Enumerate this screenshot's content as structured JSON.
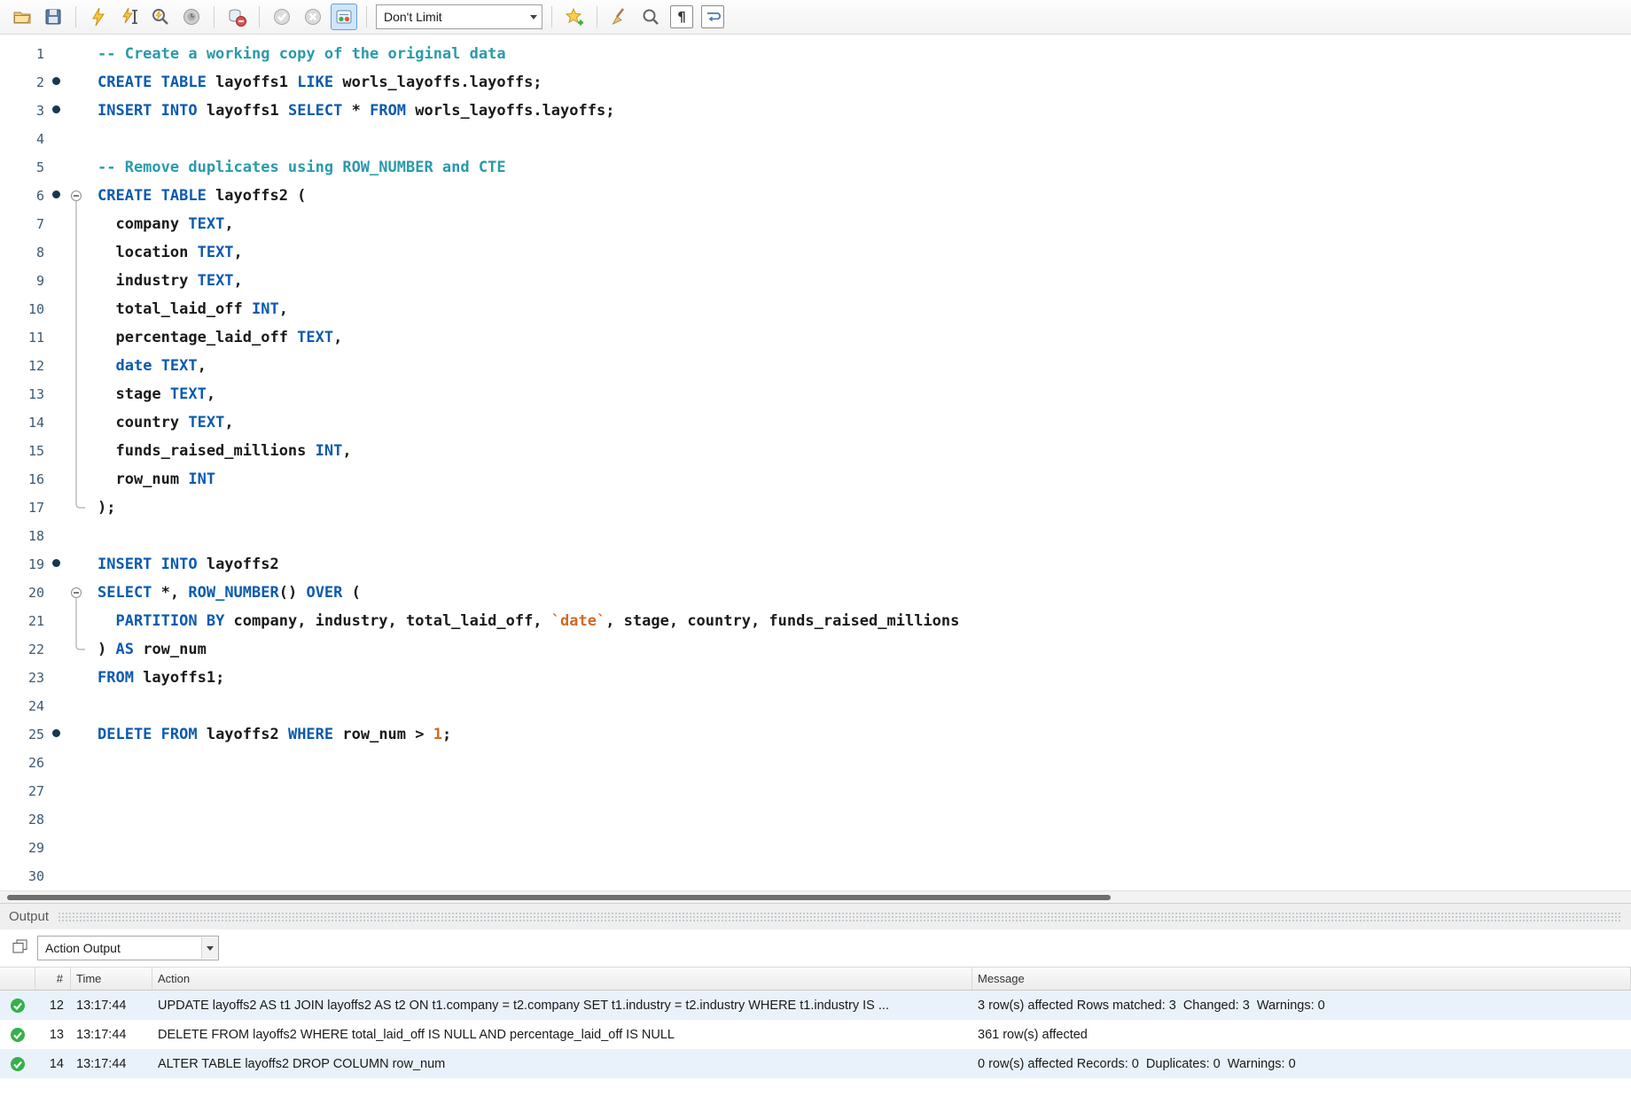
{
  "colors": {
    "keyword": "#0b5ab0",
    "comment": "#2a9aaa",
    "quoted": "#cf6a28",
    "number": "#d2691e",
    "success": "#35b04a"
  },
  "toolbar": {
    "limit_value": "Don't Limit",
    "invisibles_glyph": "¶",
    "icon_names": [
      "open-script-icon",
      "save-script-icon",
      "execute-icon",
      "execute-current-statement-icon",
      "explain-plan-icon",
      "stop-execution-icon",
      "stop-on-error-icon",
      "commit-icon",
      "rollback-icon",
      "autocommit-icon",
      "limit-rows-dropdown",
      "save-snippet-icon",
      "beautify-icon",
      "find-icon",
      "invisibles-icon",
      "wrap-text-icon"
    ]
  },
  "editor": {
    "lines": [
      {
        "n": 1,
        "seg": [
          [
            "cm",
            "-- Create a working copy of the original data"
          ]
        ]
      },
      {
        "n": 2,
        "dot": true,
        "seg": [
          [
            "kw",
            "CREATE TABLE"
          ],
          [
            "pl",
            " layoffs1 "
          ],
          [
            "kw",
            "LIKE"
          ],
          [
            "pl",
            " worls_layoffs.layoffs;"
          ]
        ]
      },
      {
        "n": 3,
        "dot": true,
        "seg": [
          [
            "kw",
            "INSERT INTO"
          ],
          [
            "pl",
            " layoffs1 "
          ],
          [
            "kw",
            "SELECT"
          ],
          [
            "pl",
            " * "
          ],
          [
            "kw",
            "FROM"
          ],
          [
            "pl",
            " worls_layoffs.layoffs;"
          ]
        ]
      },
      {
        "n": 4,
        "seg": []
      },
      {
        "n": 5,
        "seg": [
          [
            "cm",
            "-- Remove duplicates using ROW_NUMBER and CTE"
          ]
        ]
      },
      {
        "n": 6,
        "dot": true,
        "fold": "start",
        "seg": [
          [
            "kw",
            "CREATE TABLE"
          ],
          [
            "pl",
            " layoffs2 ("
          ]
        ]
      },
      {
        "n": 7,
        "fold": "mid",
        "seg": [
          [
            "pl",
            "  company "
          ],
          [
            "kw",
            "TEXT"
          ],
          [
            "pl",
            ","
          ]
        ]
      },
      {
        "n": 8,
        "fold": "mid",
        "seg": [
          [
            "pl",
            "  location "
          ],
          [
            "kw",
            "TEXT"
          ],
          [
            "pl",
            ","
          ]
        ]
      },
      {
        "n": 9,
        "fold": "mid",
        "seg": [
          [
            "pl",
            "  industry "
          ],
          [
            "kw",
            "TEXT"
          ],
          [
            "pl",
            ","
          ]
        ]
      },
      {
        "n": 10,
        "fold": "mid",
        "seg": [
          [
            "pl",
            "  total_laid_off "
          ],
          [
            "kw",
            "INT"
          ],
          [
            "pl",
            ","
          ]
        ]
      },
      {
        "n": 11,
        "fold": "mid",
        "seg": [
          [
            "pl",
            "  percentage_laid_off "
          ],
          [
            "kw",
            "TEXT"
          ],
          [
            "pl",
            ","
          ]
        ]
      },
      {
        "n": 12,
        "fold": "mid",
        "seg": [
          [
            "pl",
            "  "
          ],
          [
            "kw",
            "date"
          ],
          [
            "pl",
            " "
          ],
          [
            "kw",
            "TEXT"
          ],
          [
            "pl",
            ","
          ]
        ]
      },
      {
        "n": 13,
        "fold": "mid",
        "seg": [
          [
            "pl",
            "  stage "
          ],
          [
            "kw",
            "TEXT"
          ],
          [
            "pl",
            ","
          ]
        ]
      },
      {
        "n": 14,
        "fold": "mid",
        "seg": [
          [
            "pl",
            "  country "
          ],
          [
            "kw",
            "TEXT"
          ],
          [
            "pl",
            ","
          ]
        ]
      },
      {
        "n": 15,
        "fold": "mid",
        "seg": [
          [
            "pl",
            "  funds_raised_millions "
          ],
          [
            "kw",
            "INT"
          ],
          [
            "pl",
            ","
          ]
        ]
      },
      {
        "n": 16,
        "fold": "mid",
        "seg": [
          [
            "pl",
            "  row_num "
          ],
          [
            "kw",
            "INT"
          ]
        ]
      },
      {
        "n": 17,
        "fold": "end",
        "seg": [
          [
            "pl",
            ");"
          ]
        ]
      },
      {
        "n": 18,
        "seg": []
      },
      {
        "n": 19,
        "dot": true,
        "seg": [
          [
            "kw",
            "INSERT INTO"
          ],
          [
            "pl",
            " layoffs2"
          ]
        ]
      },
      {
        "n": 20,
        "fold": "start",
        "seg": [
          [
            "kw",
            "SELECT"
          ],
          [
            "pl",
            " *, "
          ],
          [
            "kw",
            "ROW_NUMBER"
          ],
          [
            "pl",
            "() "
          ],
          [
            "kw",
            "OVER"
          ],
          [
            "pl",
            " ("
          ]
        ]
      },
      {
        "n": 21,
        "fold": "mid",
        "seg": [
          [
            "pl",
            "  "
          ],
          [
            "kw",
            "PARTITION BY"
          ],
          [
            "pl",
            " company, industry, total_laid_off, "
          ],
          [
            "qt",
            "`date`"
          ],
          [
            "pl",
            ", stage, country, funds_raised_millions"
          ]
        ]
      },
      {
        "n": 22,
        "fold": "end",
        "seg": [
          [
            "pl",
            ") "
          ],
          [
            "kw",
            "AS"
          ],
          [
            "pl",
            " row_num"
          ]
        ]
      },
      {
        "n": 23,
        "seg": [
          [
            "kw",
            "FROM"
          ],
          [
            "pl",
            " layoffs1;"
          ]
        ]
      },
      {
        "n": 24,
        "seg": []
      },
      {
        "n": 25,
        "dot": true,
        "seg": [
          [
            "kw",
            "DELETE FROM"
          ],
          [
            "pl",
            " layoffs2 "
          ],
          [
            "kw",
            "WHERE"
          ],
          [
            "pl",
            " row_num > "
          ],
          [
            "nu",
            "1"
          ],
          [
            "pl",
            ";"
          ]
        ]
      },
      {
        "n": 26,
        "seg": []
      },
      {
        "n": 27,
        "seg": []
      },
      {
        "n": 28,
        "seg": []
      },
      {
        "n": 29,
        "seg": []
      },
      {
        "n": 30,
        "seg": []
      }
    ]
  },
  "output": {
    "title": "Output",
    "view_selector": "Action Output",
    "columns": [
      "#",
      "Time",
      "Action",
      "Message"
    ],
    "rows": [
      {
        "num": "12",
        "time": "13:17:44",
        "action": "UPDATE layoffs2 AS t1 JOIN layoffs2 AS t2 ON t1.company = t2.company SET t1.industry = t2.industry WHERE t1.industry IS ...",
        "message": "3 row(s) affected Rows matched: 3  Changed: 3  Warnings: 0"
      },
      {
        "num": "13",
        "time": "13:17:44",
        "action": "DELETE FROM layoffs2 WHERE total_laid_off IS NULL AND percentage_laid_off IS NULL",
        "message": "361 row(s) affected"
      },
      {
        "num": "14",
        "time": "13:17:44",
        "action": "ALTER TABLE layoffs2 DROP COLUMN row_num",
        "message": "0 row(s) affected Records: 0  Duplicates: 0  Warnings: 0"
      }
    ]
  }
}
